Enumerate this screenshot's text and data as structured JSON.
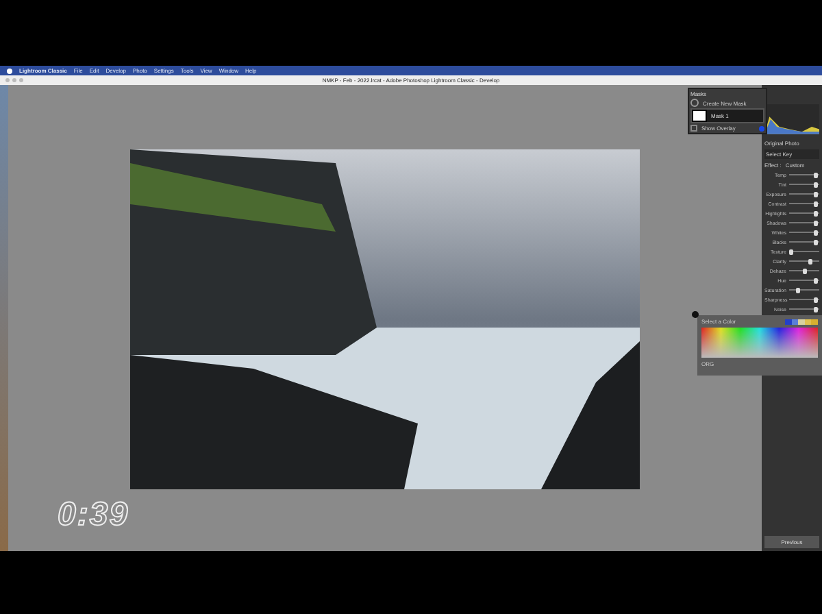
{
  "menu_bar": {
    "items": [
      "Lightroom Classic",
      "File",
      "Edit",
      "Develop",
      "Photo",
      "Settings",
      "Tools",
      "View",
      "Window",
      "Help"
    ]
  },
  "window": {
    "title": "NMKP - Feb - 2022.lrcat - Adobe Photoshop Lightroom Classic - Develop"
  },
  "timer": "0:39",
  "masks_panel": {
    "title": "Masks",
    "create_label": "Create New Mask",
    "masks": [
      {
        "name": "Mask 1",
        "selected": true
      }
    ],
    "show_overlay": {
      "label": "Show Overlay",
      "checked": false
    }
  },
  "color_picker": {
    "title": "Select a Color",
    "value": "ORG"
  },
  "right_panel": {
    "original_photo_label": "Original Photo",
    "select_key_label": "Select Key",
    "effect_label": "Effect :",
    "effect_value": "Custom",
    "sliders": [
      {
        "label": "Temp",
        "level": 0.9
      },
      {
        "label": "Tint",
        "level": 0.9
      },
      {
        "label": "Exposure",
        "level": 0.9
      },
      {
        "label": "Contrast",
        "level": 0.9
      },
      {
        "label": "Highlights",
        "level": 0.9
      },
      {
        "label": "Shadows",
        "level": 0.9
      },
      {
        "label": "Whites",
        "level": 0.9
      },
      {
        "label": "Blacks",
        "level": 0.9
      },
      {
        "label": "Texture",
        "level": 0.05
      },
      {
        "label": "Clarity",
        "level": 0.7
      },
      {
        "label": "Dehaze",
        "level": 0.5
      },
      {
        "label": "Hue",
        "level": 0.9
      },
      {
        "label": "Saturation",
        "level": 0.3
      },
      {
        "label": "Sharpness",
        "level": 0.9
      },
      {
        "label": "Noise",
        "level": 0.9
      }
    ],
    "previous_button": "Previous"
  }
}
